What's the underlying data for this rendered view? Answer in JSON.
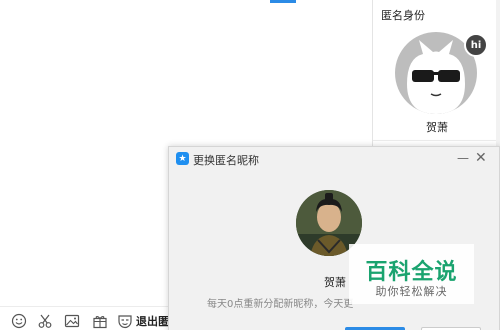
{
  "right_panel": {
    "title": "匿名身份",
    "badge": "hi",
    "name": "贺萧"
  },
  "toolbar": {
    "icons": [
      "emoji-icon",
      "scissors-icon",
      "image-icon",
      "gift-icon",
      "mask-icon"
    ],
    "exit_label": "退出匿名"
  },
  "dialog": {
    "title": "更换匿名昵称",
    "logo_glyph": "★",
    "minimize_glyph": "—",
    "close_glyph": "✕",
    "name": "贺萧",
    "notice": "每天0点重新分配新昵称，今天更"
  },
  "watermark": {
    "main": "百科全说",
    "sub": "助你轻松解决"
  },
  "colors": {
    "accent": "#2b8be6",
    "watermark_green": "#1aa36f"
  }
}
